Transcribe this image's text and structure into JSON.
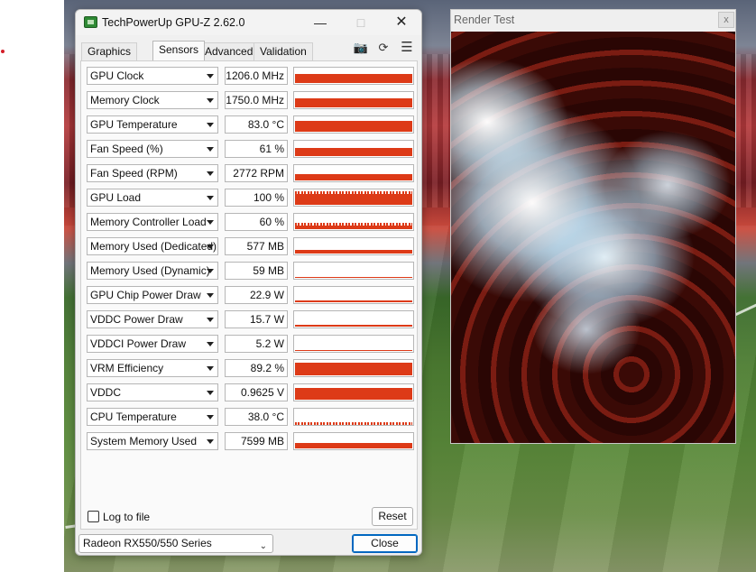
{
  "gpuz": {
    "title": "TechPowerUp GPU-Z 2.62.0",
    "tabs": [
      {
        "label": "Graphics Card"
      },
      {
        "label": "Sensors"
      },
      {
        "label": "Advanced"
      },
      {
        "label": "Validation"
      }
    ],
    "sensors": [
      {
        "name": "GPU Clock",
        "value": "1206.0 MHz",
        "level": 0.62
      },
      {
        "name": "Memory Clock",
        "value": "1750.0 MHz",
        "level": 0.62
      },
      {
        "name": "GPU Temperature",
        "value": "83.0 °C",
        "level": 0.78
      },
      {
        "name": "Fan Speed (%)",
        "value": "61 %",
        "level": 0.55
      },
      {
        "name": "Fan Speed (RPM)",
        "value": "2772 RPM",
        "level": 0.45
      },
      {
        "name": "GPU Load",
        "value": "100 %",
        "level": 0.95
      },
      {
        "name": "Memory Controller Load",
        "value": "60 %",
        "level": 0.45
      },
      {
        "name": "Memory Used (Dedicated)",
        "value": "577 MB",
        "level": 0.25
      },
      {
        "name": "Memory Used (Dynamic)",
        "value": "59 MB",
        "level": 0.05
      },
      {
        "name": "GPU Chip Power Draw",
        "value": "22.9 W",
        "level": 0.15
      },
      {
        "name": "VDDC Power Draw",
        "value": "15.7 W",
        "level": 0.1
      },
      {
        "name": "VDDCI Power Draw",
        "value": "5.2 W",
        "level": 0.06
      },
      {
        "name": "VRM Efficiency",
        "value": "89.2 %",
        "level": 0.9
      },
      {
        "name": "VDDC",
        "value": "0.9625 V",
        "level": 0.8
      },
      {
        "name": "CPU Temperature",
        "value": "38.0 °C",
        "level": 0.12
      },
      {
        "name": "System Memory Used",
        "value": "7599 MB",
        "level": 0.4
      }
    ],
    "log_to_file_label": "Log to file",
    "reset_label": "Reset",
    "close_label": "Close",
    "gpu_selected": "Radeon RX550/550 Series",
    "graph_color": "#dd3a17"
  },
  "render": {
    "title": "Render Test",
    "close_glyph": "x"
  }
}
